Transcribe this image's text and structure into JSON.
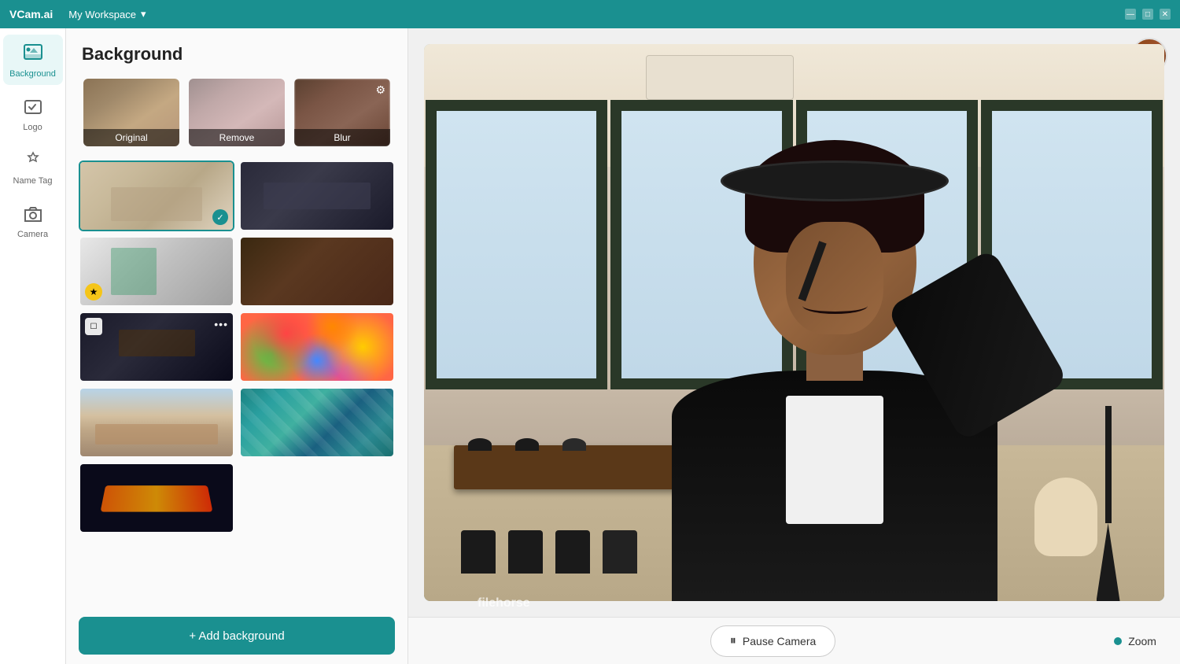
{
  "titleBar": {
    "logo": "VCam.ai",
    "workspace": "My Workspace",
    "chevron": "▾",
    "controls": [
      "—",
      "□",
      "✕"
    ]
  },
  "sidebar": {
    "items": [
      {
        "id": "background",
        "label": "Background",
        "active": true
      },
      {
        "id": "logo",
        "label": "Logo",
        "active": false
      },
      {
        "id": "nametag",
        "label": "Name Tag",
        "active": false
      },
      {
        "id": "camera",
        "label": "Camera",
        "active": false
      }
    ]
  },
  "panel": {
    "title": "Background",
    "presets": [
      {
        "id": "original",
        "label": "Original"
      },
      {
        "id": "remove",
        "label": "Remove"
      },
      {
        "id": "blur",
        "label": "Blur"
      }
    ],
    "addButton": "+ Add background",
    "thumbnails": [
      {
        "id": "office-bright",
        "selected": true,
        "premium": false
      },
      {
        "id": "office-dark",
        "selected": false,
        "premium": false
      },
      {
        "id": "modern-gray",
        "selected": false,
        "premium": true
      },
      {
        "id": "office-warm",
        "selected": false,
        "premium": false
      },
      {
        "id": "dark-room",
        "selected": false,
        "premium": false,
        "hasMore": true
      },
      {
        "id": "colorful-balls",
        "selected": false,
        "premium": false
      },
      {
        "id": "living-room",
        "selected": false,
        "premium": false
      },
      {
        "id": "teal-marble",
        "selected": false,
        "premium": false
      },
      {
        "id": "laptop-glow",
        "selected": false,
        "premium": false
      }
    ]
  },
  "camera": {
    "pauseButton": "Pause Camera",
    "zoomLabel": "Zoom"
  },
  "watermark": "filehorse",
  "icons": {
    "background": "🖼",
    "logo": "🏷",
    "nametag": "🏷",
    "camera": "📷",
    "pause": "⏸",
    "plus": "+",
    "check": "✓",
    "star": "★",
    "gear": "⚙",
    "dots": "•••"
  }
}
